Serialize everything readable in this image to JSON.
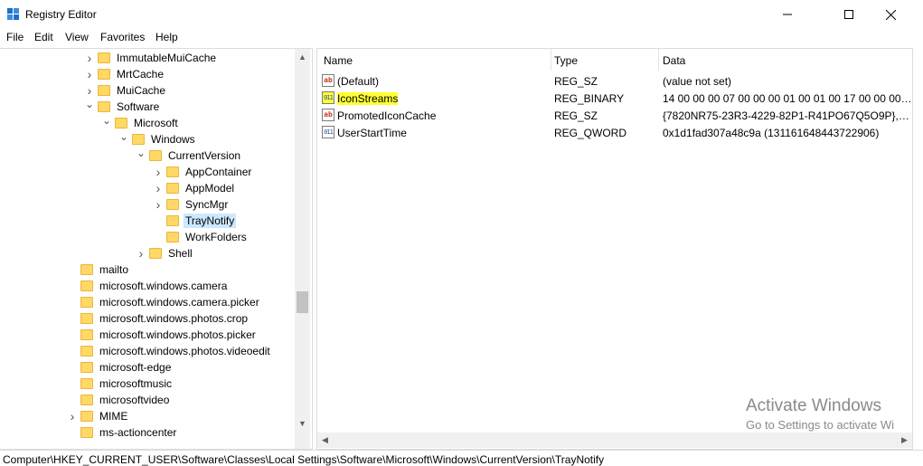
{
  "window": {
    "title": "Registry Editor"
  },
  "menu": [
    "File",
    "Edit",
    "View",
    "Favorites",
    "Help"
  ],
  "tree": [
    {
      "label": "ImmutableMuiCache",
      "level": 0,
      "expander": "collapsed"
    },
    {
      "label": "MrtCache",
      "level": 0,
      "expander": "collapsed"
    },
    {
      "label": "MuiCache",
      "level": 0,
      "expander": "collapsed"
    },
    {
      "label": "Software",
      "level": 0,
      "expander": "expanded"
    },
    {
      "label": "Microsoft",
      "level": 1,
      "expander": "expanded"
    },
    {
      "label": "Windows",
      "level": 2,
      "expander": "expanded"
    },
    {
      "label": "CurrentVersion",
      "level": 3,
      "expander": "expanded"
    },
    {
      "label": "AppContainer",
      "level": 4,
      "expander": "collapsed"
    },
    {
      "label": "AppModel",
      "level": 4,
      "expander": "collapsed"
    },
    {
      "label": "SyncMgr",
      "level": 4,
      "expander": "collapsed"
    },
    {
      "label": "TrayNotify",
      "level": 4,
      "expander": "none",
      "selected": true
    },
    {
      "label": "WorkFolders",
      "level": 4,
      "expander": "none"
    },
    {
      "label": "Shell",
      "level": 3,
      "expander": "collapsed"
    },
    {
      "label": "mailto",
      "level": -1,
      "expander": "none"
    },
    {
      "label": "microsoft.windows.camera",
      "level": -1,
      "expander": "none"
    },
    {
      "label": "microsoft.windows.camera.picker",
      "level": -1,
      "expander": "none"
    },
    {
      "label": "microsoft.windows.photos.crop",
      "level": -1,
      "expander": "none"
    },
    {
      "label": "microsoft.windows.photos.picker",
      "level": -1,
      "expander": "none"
    },
    {
      "label": "microsoft.windows.photos.videoedit",
      "level": -1,
      "expander": "none"
    },
    {
      "label": "microsoft-edge",
      "level": -1,
      "expander": "none"
    },
    {
      "label": "microsoftmusic",
      "level": -1,
      "expander": "none"
    },
    {
      "label": "microsoftvideo",
      "level": -1,
      "expander": "none"
    },
    {
      "label": "MIME",
      "level": -1,
      "expander": "collapsed"
    },
    {
      "label": "ms-actioncenter",
      "level": -1,
      "expander": "none"
    }
  ],
  "list": {
    "columns": [
      "Name",
      "Type",
      "Data"
    ],
    "rows": [
      {
        "icon": "ab",
        "name": "(Default)",
        "type": "REG_SZ",
        "data": "(value not set)"
      },
      {
        "icon": "bin",
        "name": "IconStreams",
        "type": "REG_BINARY",
        "data": "14 00 00 00 07 00 00 00 01 00 01 00 17 00 00 00 14 0...",
        "highlighted": true
      },
      {
        "icon": "ab",
        "name": "PromotedIconCache",
        "type": "REG_SZ",
        "data": "{7820NR75-23R3-4229-82P1-R41PO67Q5O9P},{782..."
      },
      {
        "icon": "bin",
        "name": "UserStartTime",
        "type": "REG_QWORD",
        "data": "0x1d1fad307a48c9a (131161648443722906)"
      }
    ]
  },
  "watermark": {
    "title": "Activate Windows",
    "subtitle": "Go to Settings to activate Wi"
  },
  "status": {
    "path": "Computer\\HKEY_CURRENT_USER\\Software\\Classes\\Local Settings\\Software\\Microsoft\\Windows\\CurrentVersion\\TrayNotify"
  },
  "colors": {
    "selection": "#cce8ff",
    "highlight": "#ffff33",
    "folder": "#ffd866"
  }
}
